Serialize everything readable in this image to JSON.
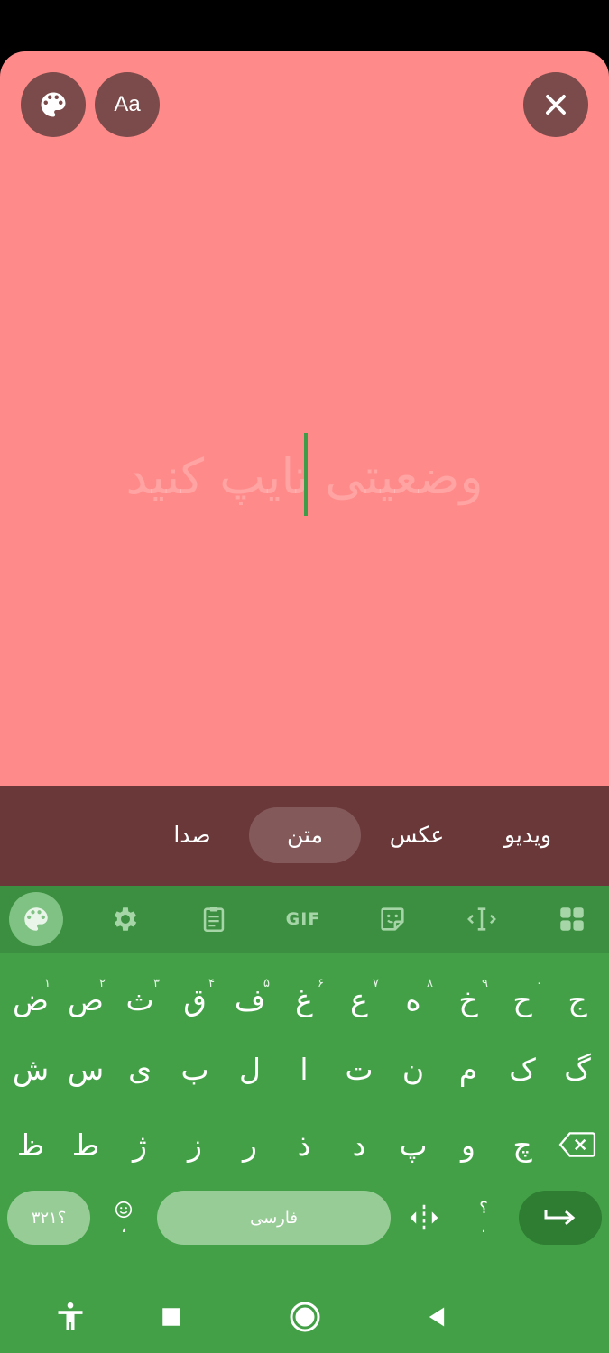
{
  "editor": {
    "placeholder": "وضعیتی تایپ کنید",
    "font_button_label": "Aa",
    "icons": [
      "palette-icon",
      "close-icon"
    ],
    "background_color": "#ff8a8a"
  },
  "modes": {
    "items": [
      {
        "label": "صدا"
      },
      {
        "label": "متن",
        "active": true
      },
      {
        "label": "عکس"
      },
      {
        "label": "ویدیو"
      }
    ]
  },
  "keyboard": {
    "toolbar": {
      "gif_label": "GIF",
      "icons": [
        "palette-icon",
        "gear-icon",
        "clipboard-icon",
        "gif-icon",
        "sticker-icon",
        "cursor-move-icon",
        "grid-icon"
      ]
    },
    "rows": [
      [
        {
          "char": "ض",
          "hint": "۱"
        },
        {
          "char": "ص",
          "hint": "۲"
        },
        {
          "char": "ث",
          "hint": "۳"
        },
        {
          "char": "ق",
          "hint": "۴"
        },
        {
          "char": "ف",
          "hint": "۵"
        },
        {
          "char": "غ",
          "hint": "۶"
        },
        {
          "char": "ع",
          "hint": "۷"
        },
        {
          "char": "ه",
          "hint": "۸"
        },
        {
          "char": "خ",
          "hint": "۹"
        },
        {
          "char": "ح",
          "hint": "۰"
        },
        {
          "char": "ج",
          "hint": ""
        }
      ],
      [
        {
          "char": "ش"
        },
        {
          "char": "س"
        },
        {
          "char": "ی"
        },
        {
          "char": "ب"
        },
        {
          "char": "ل"
        },
        {
          "char": "ا"
        },
        {
          "char": "ت"
        },
        {
          "char": "ن"
        },
        {
          "char": "م"
        },
        {
          "char": "ک"
        },
        {
          "char": "گ"
        }
      ],
      [
        {
          "char": "ظ"
        },
        {
          "char": "ط"
        },
        {
          "char": "ژ"
        },
        {
          "char": "ز"
        },
        {
          "char": "ر"
        },
        {
          "char": "ذ"
        },
        {
          "char": "د"
        },
        {
          "char": "پ"
        },
        {
          "char": "و"
        },
        {
          "char": "چ"
        }
      ]
    ],
    "bottom": {
      "symbols_label": "؟۳۲۱",
      "emoji_sub": "،",
      "space_label": "فارسی",
      "punct_top": "؟",
      "punct_bottom": "."
    },
    "colors": {
      "background": "#43a047",
      "enter": "#2e7d32"
    }
  },
  "navbar": {
    "icons": [
      "accessibility-icon",
      "recents-icon",
      "home-icon",
      "back-icon"
    ]
  }
}
